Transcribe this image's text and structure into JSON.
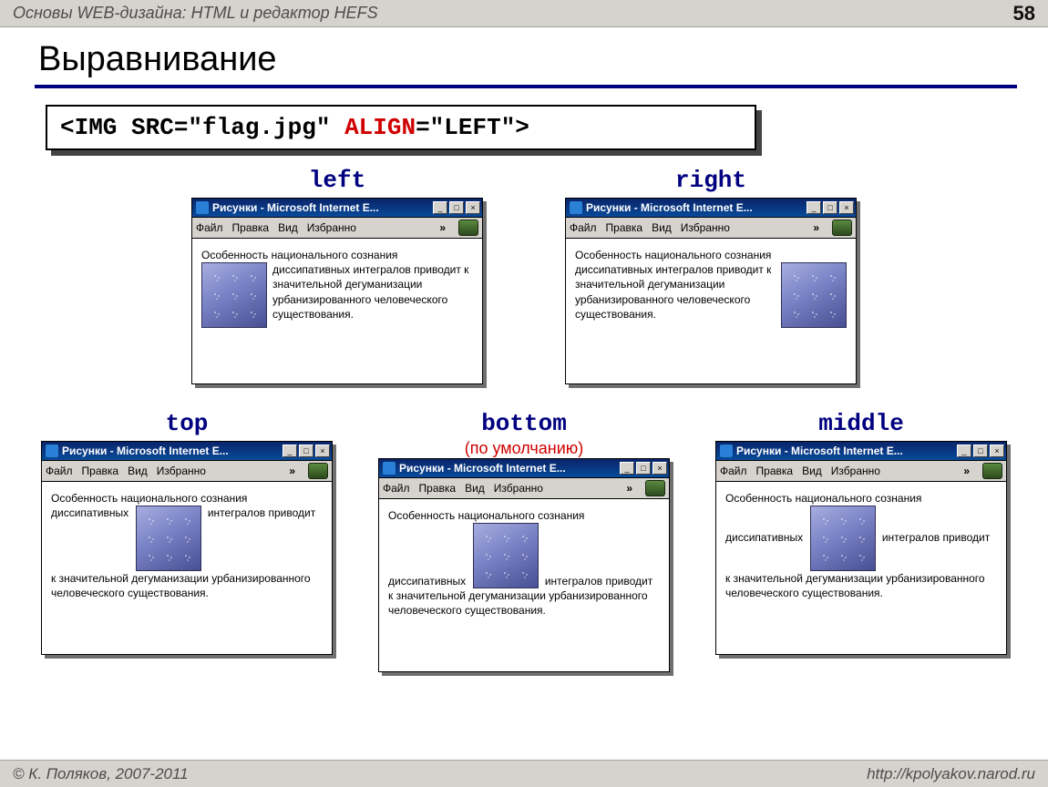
{
  "header": {
    "course_title": "Основы WEB-дизайна: HTML и редактор HEFS",
    "page_number": "58"
  },
  "slide": {
    "title": "Выравнивание"
  },
  "code": {
    "open": "<IMG SRC=\"flag.jpg\" ",
    "attr": "ALIGN",
    "rest": "=\"LEFT\">"
  },
  "labels": {
    "left": "left",
    "right": "right",
    "top": "top",
    "bottom": "bottom",
    "bottom_note": "(по умолчанию)",
    "middle": "middle"
  },
  "ie": {
    "title": "Рисунки - Microsoft Internet E...",
    "win_min": "_",
    "win_max": "□",
    "win_close": "×",
    "menu_file": "Файл",
    "menu_edit": "Правка",
    "menu_view": "Вид",
    "menu_fav": "Избранно",
    "chevron": "»"
  },
  "sample": {
    "t1": "Особенность национального сознания диссипативных интегралов приводит к ",
    "t2": "значительной дегуманизации урбанизированного человеческого существования.",
    "w1": "Особенность национального сознания",
    "w2a": "диссипативных",
    "w2b": "интегралов",
    "w3": "приводит к значительной дегуманизации урбанизированного человеческого существования."
  },
  "footer": {
    "copyright": "© К. Поляков, 2007-2011",
    "url": "http://kpolyakov.narod.ru"
  }
}
